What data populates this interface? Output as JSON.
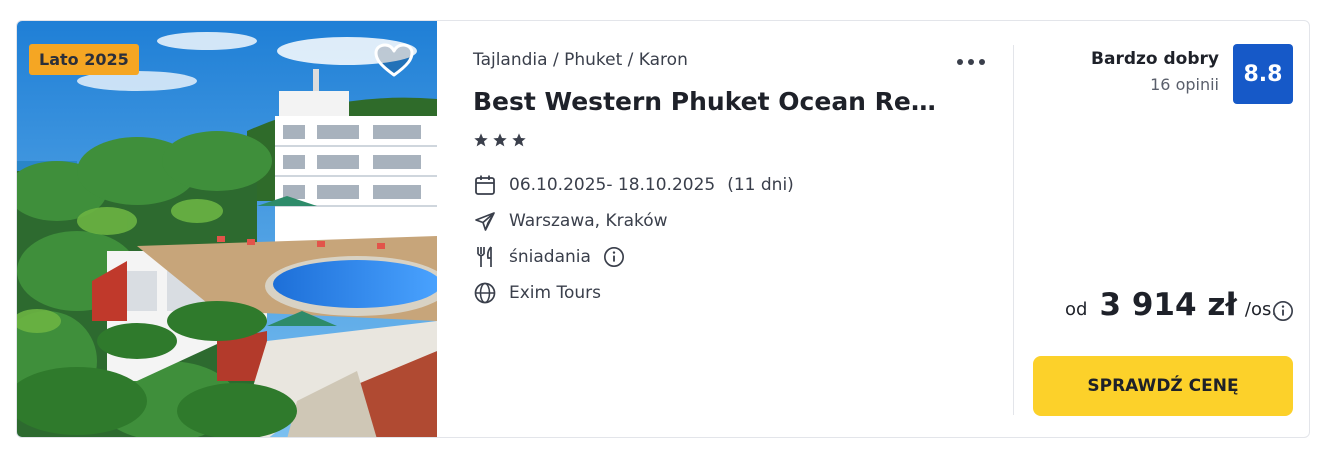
{
  "offer": {
    "badge": "Lato 2025",
    "breadcrumb": "Tajlandia / Phuket / Karon",
    "title": "Best Western Phuket Ocean Re…",
    "stars": 3,
    "dates": "06.10.2025- 18.10.2025",
    "duration": "(11 dni)",
    "departure": "Warszawa, Kraków",
    "board": "śniadania",
    "operator": "Exim Tours",
    "rating": {
      "label": "Bardzo dobry",
      "count": "16 opinii",
      "score": "8.8"
    },
    "price": {
      "prefix": "od",
      "amount": "3 914 zł",
      "suffix": "/os."
    },
    "cta": "SPRAWDŹ CENĘ"
  },
  "colors": {
    "badge": "#f5a623",
    "score": "#1659c8",
    "cta": "#fcd12a"
  },
  "icons": {
    "favorite": "heart-icon",
    "more": "more-dots-icon",
    "dates": "calendar-icon",
    "departure": "plane-icon",
    "board": "fork-knife-icon",
    "operator": "globe-icon",
    "info": "info-icon"
  }
}
